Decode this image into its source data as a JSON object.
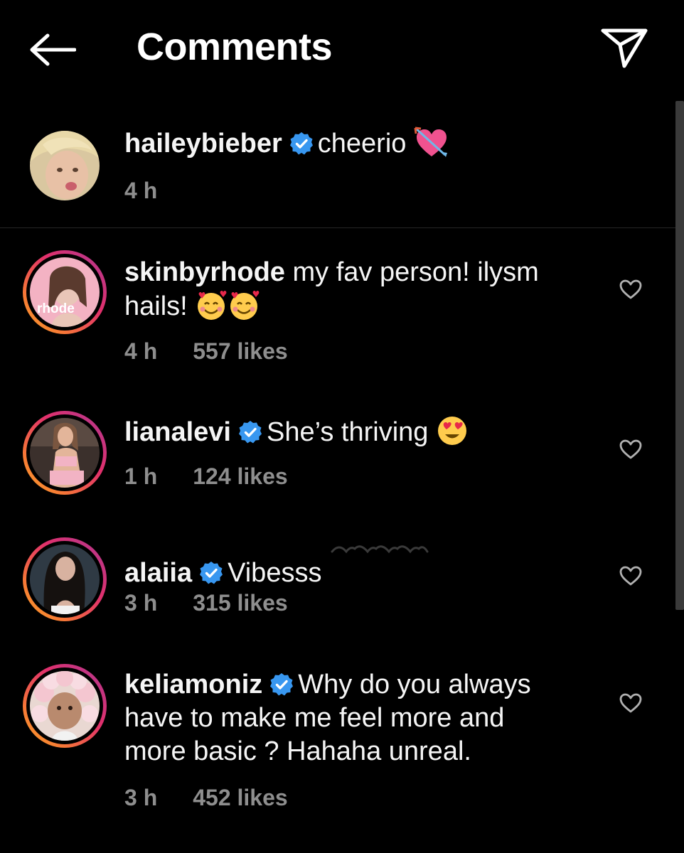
{
  "header": {
    "title": "Comments",
    "back_icon": "arrow-left-icon",
    "share_icon": "paper-plane-icon"
  },
  "caption": {
    "username": "haileybieber",
    "verified": true,
    "text": "cheerio",
    "emoji": "heart-with-arrow",
    "time": "4 h"
  },
  "comments": [
    {
      "username": "skinbyrhode",
      "verified": false,
      "text": "my fav person! ilysm hails!",
      "emoji": "smiling-face-with-hearts x2",
      "avatar_label": "rhode",
      "time": "4 h",
      "likes": "557 likes"
    },
    {
      "username": "lianalevi",
      "verified": true,
      "text": "She’s thriving",
      "emoji": "heart-eyes",
      "time": "1 h",
      "likes": "124 likes"
    },
    {
      "username": "alaiia",
      "verified": true,
      "text": "Vibesss",
      "emoji": "curly-loop x5",
      "time": "3 h",
      "likes": "315 likes"
    },
    {
      "username": "keliamoniz",
      "verified": true,
      "text": "Why do you always have to make me feel more and more basic ? Hahaha unreal.",
      "time": "3 h",
      "likes": "452 likes"
    }
  ],
  "colors": {
    "background": "#000000",
    "text": "#f5f5f5",
    "meta": "#8e8e8e",
    "verified": "#3897f0",
    "divider": "#262626",
    "story_ring_start": "#f9a825",
    "story_ring_end": "#b232a6"
  }
}
